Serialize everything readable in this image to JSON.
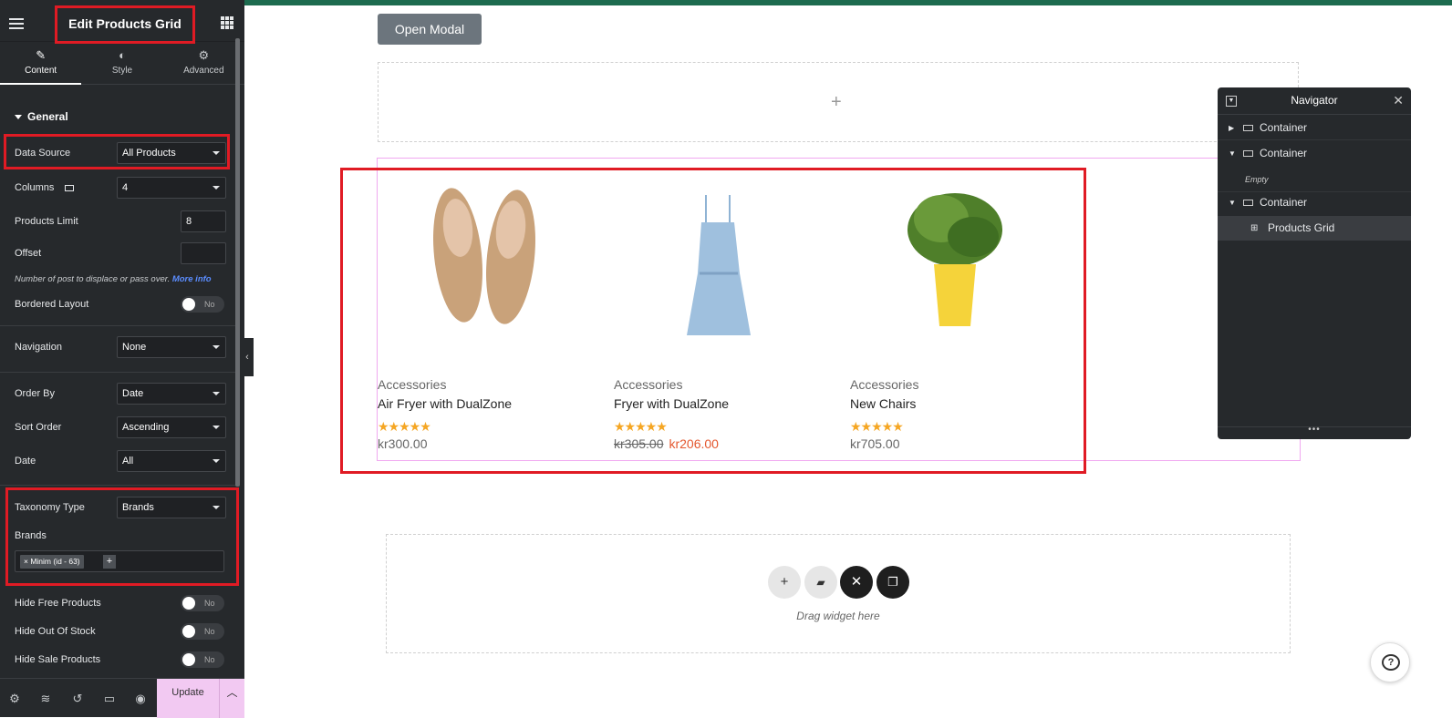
{
  "colors": {
    "accent": "#e01b24",
    "panel_bg": "#26292c",
    "update_bg": "#f2c9f2"
  },
  "panel": {
    "title": "Edit Products Grid",
    "tabs": [
      {
        "label": "Content",
        "icon": "pencil-icon"
      },
      {
        "label": "Style",
        "icon": "contrast-icon"
      },
      {
        "label": "Advanced",
        "icon": "gear-icon"
      }
    ],
    "section": "General",
    "data_source": {
      "label": "Data Source",
      "value": "All Products"
    },
    "columns": {
      "label": "Columns",
      "value": "4"
    },
    "products_limit": {
      "label": "Products Limit",
      "value": "8"
    },
    "offset": {
      "label": "Offset",
      "value": ""
    },
    "hint": "Number of post to displace or pass over.",
    "hint_link": "More info",
    "bordered": {
      "label": "Bordered Layout",
      "toggle": "No"
    },
    "navigation": {
      "label": "Navigation",
      "value": "None"
    },
    "order_by": {
      "label": "Order By",
      "value": "Date"
    },
    "sort_order": {
      "label": "Sort Order",
      "value": "Ascending"
    },
    "date": {
      "label": "Date",
      "value": "All"
    },
    "taxonomy": {
      "label": "Taxonomy Type",
      "value": "Brands"
    },
    "brands": {
      "label": "Brands",
      "tag": "× Minim (id - 63)",
      "add": "+"
    },
    "hide_free": {
      "label": "Hide Free Products",
      "toggle": "No"
    },
    "hide_oos": {
      "label": "Hide Out Of Stock",
      "toggle": "No"
    },
    "hide_sale": {
      "label": "Hide Sale Products",
      "toggle": "No"
    },
    "update": "Update"
  },
  "canvas": {
    "open_modal": "Open Modal",
    "plus": "+",
    "products": [
      {
        "category": "Accessories",
        "name": "Air Fryer with DualZone",
        "stars": "★★★★★",
        "price": "kr300.00",
        "old_price": "",
        "sale_price": ""
      },
      {
        "category": "Accessories",
        "name": "Fryer with DualZone",
        "stars": "★★★★★",
        "price": "",
        "old_price": "kr305.00",
        "sale_price": "kr206.00"
      },
      {
        "category": "Accessories",
        "name": "New Chairs",
        "stars": "★★★★★",
        "price": "kr705.00",
        "old_price": "",
        "sale_price": ""
      }
    ],
    "dropzone_text": "Drag widget here"
  },
  "navigator": {
    "title": "Navigator",
    "items": [
      "Container",
      "Container",
      "Container",
      "Products Grid"
    ],
    "empty": "Empty",
    "dots": "•••"
  }
}
